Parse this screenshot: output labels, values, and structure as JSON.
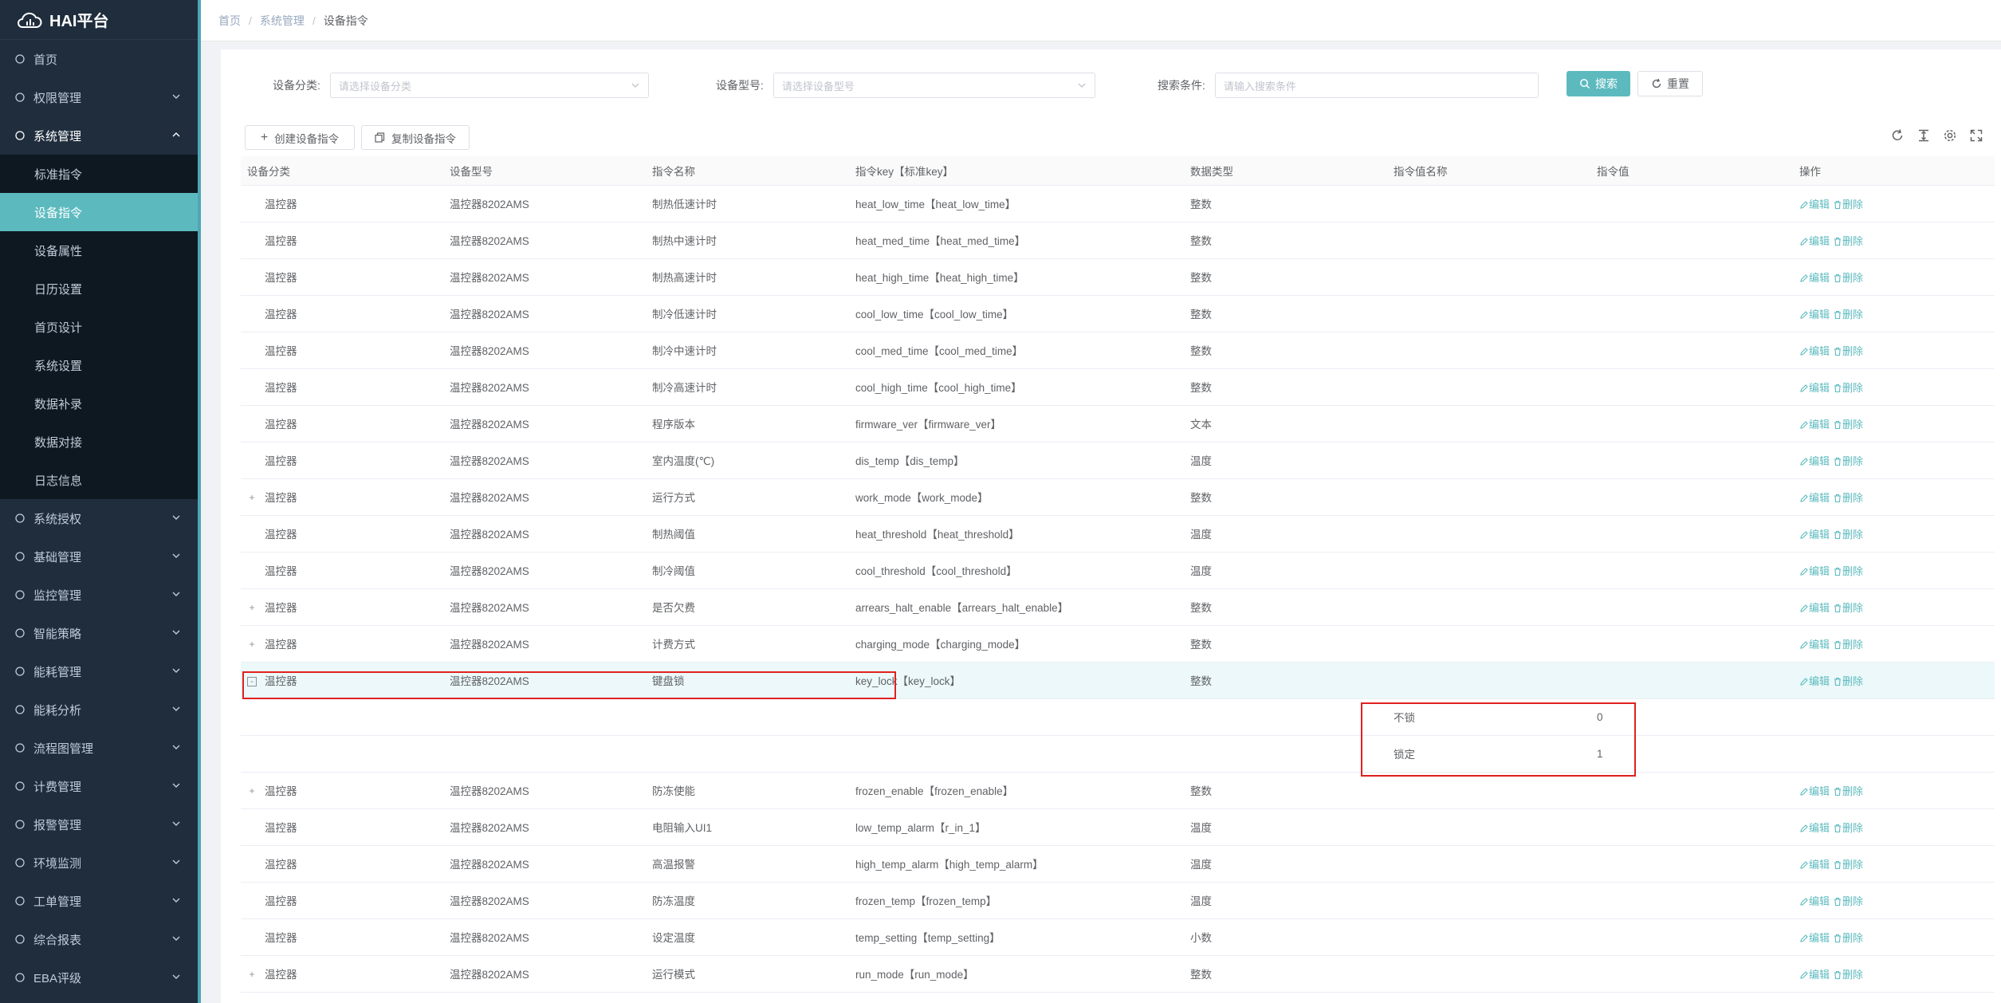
{
  "app": {
    "title": "HAI平台"
  },
  "sidebar": {
    "items": [
      {
        "label": "首页",
        "icon": "home-icon",
        "expandable": false
      },
      {
        "label": "权限管理",
        "icon": "shield-icon",
        "expandable": true
      },
      {
        "label": "系统管理",
        "icon": "settings-icon",
        "expandable": true,
        "open": true
      },
      {
        "label": "系统授权",
        "icon": "license-icon",
        "expandable": true
      },
      {
        "label": "基础管理",
        "icon": "grid-icon",
        "expandable": true
      },
      {
        "label": "监控管理",
        "icon": "monitor-icon",
        "expandable": true
      },
      {
        "label": "智能策略",
        "icon": "location-icon",
        "expandable": true
      },
      {
        "label": "能耗管理",
        "icon": "sliders-icon",
        "expandable": true
      },
      {
        "label": "能耗分析",
        "icon": "chart-icon",
        "expandable": true
      },
      {
        "label": "流程图管理",
        "icon": "flow-icon",
        "expandable": true
      },
      {
        "label": "计费管理",
        "icon": "billing-icon",
        "expandable": true
      },
      {
        "label": "报警管理",
        "icon": "alarm-icon",
        "expandable": true
      },
      {
        "label": "环境监测",
        "icon": "leaf-icon",
        "expandable": true
      },
      {
        "label": "工单管理",
        "icon": "layers-icon",
        "expandable": true
      },
      {
        "label": "综合报表",
        "icon": "report-icon",
        "expandable": true
      },
      {
        "label": "EBA评级",
        "icon": "rating-icon",
        "expandable": true
      }
    ],
    "submenu": [
      "标准指令",
      "设备指令",
      "设备属性",
      "日历设置",
      "首页设计",
      "系统设置",
      "数据补录",
      "数据对接",
      "日志信息"
    ],
    "active_sub": "设备指令"
  },
  "breadcrumb": {
    "items": [
      "首页",
      "系统管理",
      "设备指令"
    ],
    "sep": "/"
  },
  "search": {
    "category_label": "设备分类:",
    "category_placeholder": "请选择设备分类",
    "model_label": "设备型号:",
    "model_placeholder": "请选择设备型号",
    "query_label": "搜索条件:",
    "query_placeholder": "请输入搜索条件",
    "search_btn": "搜索",
    "reset_btn": "重置"
  },
  "toolbar": {
    "create_btn": "创建设备指令",
    "copy_btn": "复制设备指令"
  },
  "table": {
    "headers": [
      "设备分类",
      "设备型号",
      "指令名称",
      "指令key【标准key】",
      "数据类型",
      "指令值名称",
      "指令值",
      "操作"
    ],
    "edit_label": "编辑",
    "delete_label": "删除",
    "rows": [
      {
        "exp": "",
        "cat": "温控器",
        "model": "温控器8202AMS",
        "name": "制热低速计时",
        "key": "heat_low_time【heat_low_time】",
        "type": "整数"
      },
      {
        "exp": "",
        "cat": "温控器",
        "model": "温控器8202AMS",
        "name": "制热中速计时",
        "key": "heat_med_time【heat_med_time】",
        "type": "整数"
      },
      {
        "exp": "",
        "cat": "温控器",
        "model": "温控器8202AMS",
        "name": "制热高速计时",
        "key": "heat_high_time【heat_high_time】",
        "type": "整数"
      },
      {
        "exp": "",
        "cat": "温控器",
        "model": "温控器8202AMS",
        "name": "制冷低速计时",
        "key": "cool_low_time【cool_low_time】",
        "type": "整数"
      },
      {
        "exp": "",
        "cat": "温控器",
        "model": "温控器8202AMS",
        "name": "制冷中速计时",
        "key": "cool_med_time【cool_med_time】",
        "type": "整数"
      },
      {
        "exp": "",
        "cat": "温控器",
        "model": "温控器8202AMS",
        "name": "制冷高速计时",
        "key": "cool_high_time【cool_high_time】",
        "type": "整数"
      },
      {
        "exp": "",
        "cat": "温控器",
        "model": "温控器8202AMS",
        "name": "程序版本",
        "key": "firmware_ver【firmware_ver】",
        "type": "文本"
      },
      {
        "exp": "",
        "cat": "温控器",
        "model": "温控器8202AMS",
        "name": "室内温度(℃)",
        "key": "dis_temp【dis_temp】",
        "type": "温度"
      },
      {
        "exp": "+",
        "cat": "温控器",
        "model": "温控器8202AMS",
        "name": "运行方式",
        "key": "work_mode【work_mode】",
        "type": "整数"
      },
      {
        "exp": "",
        "cat": "温控器",
        "model": "温控器8202AMS",
        "name": "制热阈值",
        "key": "heat_threshold【heat_threshold】",
        "type": "温度"
      },
      {
        "exp": "",
        "cat": "温控器",
        "model": "温控器8202AMS",
        "name": "制冷阈值",
        "key": "cool_threshold【cool_threshold】",
        "type": "温度"
      },
      {
        "exp": "+",
        "cat": "温控器",
        "model": "温控器8202AMS",
        "name": "是否欠费",
        "key": "arrears_halt_enable【arrears_halt_enable】",
        "type": "整数"
      },
      {
        "exp": "+",
        "cat": "温控器",
        "model": "温控器8202AMS",
        "name": "计费方式",
        "key": "charging_mode【charging_mode】",
        "type": "整数"
      },
      {
        "exp": "-",
        "cat": "温控器",
        "model": "温控器8202AMS",
        "name": "键盘锁",
        "key": "key_lock【key_lock】",
        "type": "整数",
        "highlight": true,
        "children": [
          {
            "vname": "不锁",
            "value": "0"
          },
          {
            "vname": "锁定",
            "value": "1"
          }
        ]
      },
      {
        "exp": "+",
        "cat": "温控器",
        "model": "温控器8202AMS",
        "name": "防冻使能",
        "key": "frozen_enable【frozen_enable】",
        "type": "整数"
      },
      {
        "exp": "",
        "cat": "温控器",
        "model": "温控器8202AMS",
        "name": "电阻输入UI1",
        "key": "low_temp_alarm【r_in_1】",
        "type": "温度"
      },
      {
        "exp": "",
        "cat": "温控器",
        "model": "温控器8202AMS",
        "name": "高温报警",
        "key": "high_temp_alarm【high_temp_alarm】",
        "type": "温度"
      },
      {
        "exp": "",
        "cat": "温控器",
        "model": "温控器8202AMS",
        "name": "防冻温度",
        "key": "frozen_temp【frozen_temp】",
        "type": "温度"
      },
      {
        "exp": "",
        "cat": "温控器",
        "model": "温控器8202AMS",
        "name": "设定温度",
        "key": "temp_setting【temp_setting】",
        "type": "小数"
      },
      {
        "exp": "+",
        "cat": "温控器",
        "model": "温控器8202AMS",
        "name": "运行模式",
        "key": "run_mode【run_mode】",
        "type": "整数"
      }
    ]
  },
  "colors": {
    "accent": "#5cbabf",
    "sidebar_bg": "#1f2d3d",
    "highlight_box": "#e02020"
  }
}
